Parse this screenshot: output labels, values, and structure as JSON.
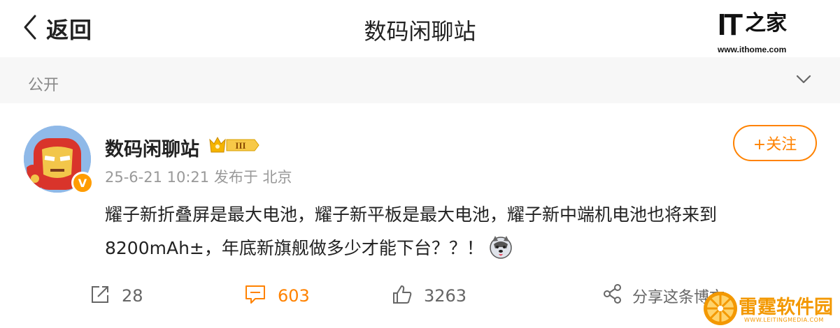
{
  "header": {
    "back_label": "返回",
    "title": "数码闲聊站",
    "logo_text": "IT之家",
    "logo_it": "IT",
    "logo_zh": "之家",
    "logo_url": "www.ithome.com"
  },
  "visibility": {
    "label": "公开",
    "icon": "chevron-down-icon"
  },
  "post": {
    "username": "数码闲聊站",
    "rank_badge": "III",
    "verified_badge": "V",
    "meta": "25-6-21 10:21 发布于 北京",
    "follow_label": "+关注",
    "content": "耀子新折叠屏是最大电池，耀子新平板是最大电池，耀子新中端机电池也将来到8200mAh±，年底新旗舰做多少才能下台？？！",
    "emoji": "husky-emoji"
  },
  "actions": {
    "repost_count": "28",
    "comment_count": "603",
    "like_count": "3263",
    "share_label": "分享这条博文"
  },
  "watermark": {
    "text": "雷霆软件园",
    "url": "WWW.LEITINGMEDIA.COM"
  },
  "colors": {
    "accent": "#ff8200",
    "secondary_text": "#999999",
    "visbar_bg": "#f7f7f7"
  }
}
